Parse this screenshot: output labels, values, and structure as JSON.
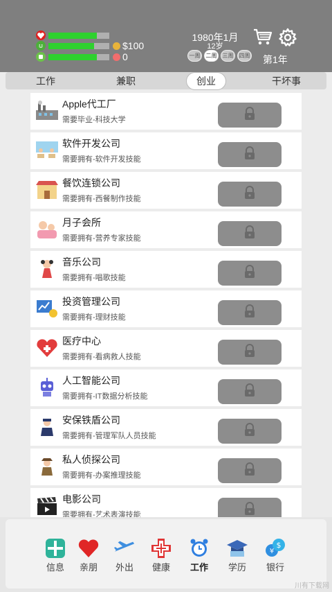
{
  "status": {
    "health_fill": 0.8,
    "happiness_fill": 0.75,
    "energy_fill": 0.8,
    "money": "$100",
    "gems": "0"
  },
  "header": {
    "date": "1980年1月",
    "age": "12岁",
    "weeks": [
      "一周",
      "二周",
      "三周",
      "四周"
    ],
    "active_week": 1,
    "year_label": "第1年"
  },
  "tabs": [
    {
      "label": "工作"
    },
    {
      "label": "兼职"
    },
    {
      "label": "创业"
    },
    {
      "label": "干坏事"
    }
  ],
  "active_tab": 2,
  "businesses": [
    {
      "title": "Apple代工厂",
      "desc": "需要毕业-科技大学",
      "icon": "factory-icon"
    },
    {
      "title": "软件开发公司",
      "desc": "需要拥有-软件开发技能",
      "icon": "software-office-icon"
    },
    {
      "title": "餐饮连锁公司",
      "desc": "需要拥有-西餐制作技能",
      "icon": "restaurant-icon"
    },
    {
      "title": "月子会所",
      "desc": "需要拥有-营养专家技能",
      "icon": "maternity-icon"
    },
    {
      "title": "音乐公司",
      "desc": "需要拥有-唱歌技能",
      "icon": "singer-icon"
    },
    {
      "title": "投资管理公司",
      "desc": "需要拥有-理财技能",
      "icon": "investment-icon"
    },
    {
      "title": "医疗中心",
      "desc": "需要拥有-看病救人技能",
      "icon": "medical-heart-icon"
    },
    {
      "title": "人工智能公司",
      "desc": "需要拥有-IT数据分析技能",
      "icon": "robot-icon"
    },
    {
      "title": "安保铁盾公司",
      "desc": "需要拥有-管理军队人员技能",
      "icon": "security-guard-icon"
    },
    {
      "title": "私人侦探公司",
      "desc": "需要拥有-办案推理技能",
      "icon": "detective-icon"
    },
    {
      "title": "电影公司",
      "desc": "需要拥有-艺术表演技能",
      "icon": "film-clapper-icon"
    }
  ],
  "nav": [
    {
      "label": "信息",
      "icon": "info-icon"
    },
    {
      "label": "亲朋",
      "icon": "heart-icon"
    },
    {
      "label": "外出",
      "icon": "airplane-icon"
    },
    {
      "label": "健康",
      "icon": "health-cross-icon"
    },
    {
      "label": "工作",
      "icon": "alarm-clock-icon"
    },
    {
      "label": "学历",
      "icon": "graduation-icon"
    },
    {
      "label": "银行",
      "icon": "bank-money-icon"
    }
  ],
  "active_nav": 4,
  "watermark": "川有下载网",
  "colors": {
    "header_bg": "#7f7f7f",
    "bar_fill": "#2ed12e",
    "lock_button": "#8d8d8d"
  }
}
